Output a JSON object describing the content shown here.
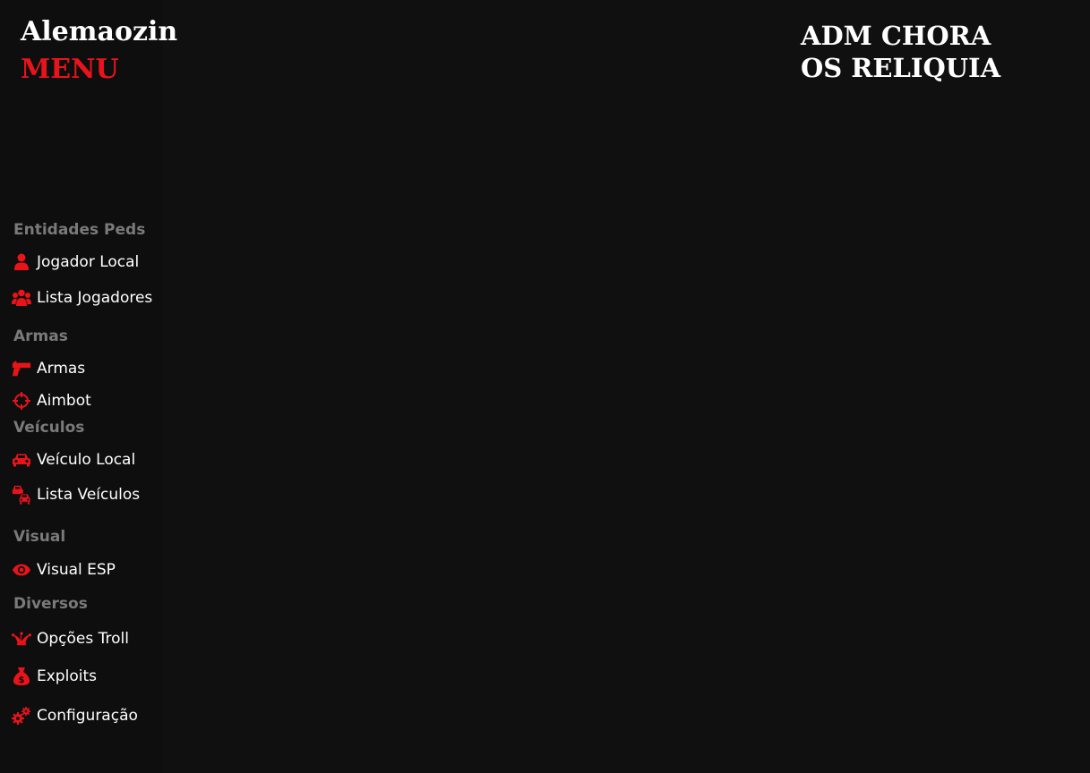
{
  "brand": {
    "name": "Alemaozin",
    "subtitle": "MENU"
  },
  "headline": {
    "line1": "ADM CHORA",
    "line2": "OS RELIQUIA"
  },
  "colors": {
    "background": "#101010",
    "accent": "#e8141a",
    "section_title": "#7a7a7a",
    "text": "#ffffff"
  },
  "sections": {
    "peds": {
      "title": "Entidades Peds",
      "items": [
        {
          "label": "Jogador Local",
          "icon": "user-icon"
        },
        {
          "label": "Lista Jogadores",
          "icon": "users-icon"
        }
      ]
    },
    "weapons": {
      "title": "Armas",
      "items": [
        {
          "label": "Armas",
          "icon": "gun-icon"
        },
        {
          "label": "Aimbot",
          "icon": "crosshair-icon"
        }
      ]
    },
    "vehicles": {
      "title": "Veículos",
      "items": [
        {
          "label": "Veículo Local",
          "icon": "car-icon"
        },
        {
          "label": "Lista Veículos",
          "icon": "cars-icon"
        }
      ]
    },
    "visual": {
      "title": "Visual",
      "items": [
        {
          "label": "Visual ESP",
          "icon": "eye-icon"
        }
      ]
    },
    "misc": {
      "title": "Diversos",
      "items": [
        {
          "label": "Opções Troll",
          "icon": "jester-hat-icon"
        },
        {
          "label": "Exploits",
          "icon": "money-bag-icon"
        },
        {
          "label": "Configuração",
          "icon": "gears-icon"
        }
      ]
    }
  }
}
